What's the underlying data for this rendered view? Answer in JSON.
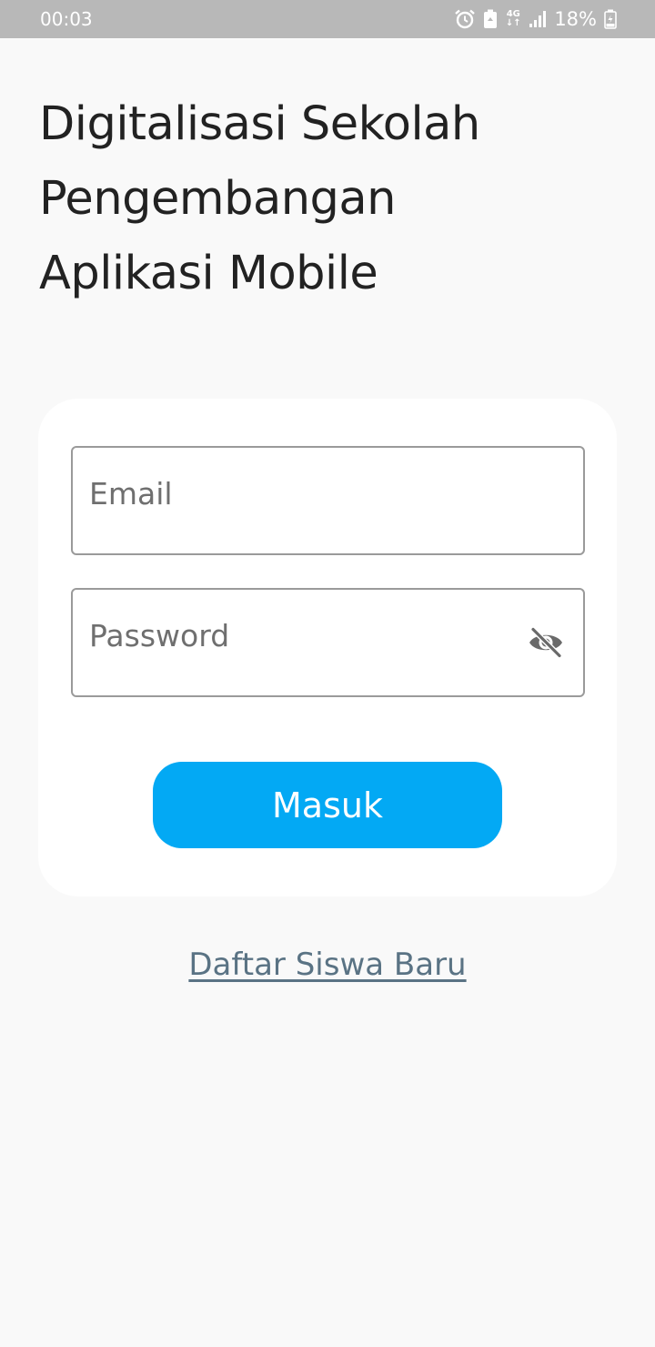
{
  "status_bar": {
    "time": "00:03",
    "network": "4G",
    "battery_percent": "18%",
    "icons": [
      "alarm-icon",
      "battery-saver-icon",
      "network-4g-icon",
      "signal-icon",
      "battery-charging-icon"
    ]
  },
  "app": {
    "title_lines": [
      "Digitalisasi Sekolah",
      "Pengembangan",
      "Aplikasi Mobile"
    ]
  },
  "login_form": {
    "email_placeholder": "Email",
    "email_value": "",
    "password_placeholder": "Password",
    "password_value": "",
    "password_toggle_icon": "eye-off-icon",
    "submit_label": "Masuk"
  },
  "register_link": "Daftar Siswa Baru",
  "colors": {
    "status_bar": "#b8b8b8",
    "background": "#f9f9f9",
    "card": "#ffffff",
    "primary": "#03a9f4",
    "link": "#5a7384",
    "title": "#222222"
  }
}
